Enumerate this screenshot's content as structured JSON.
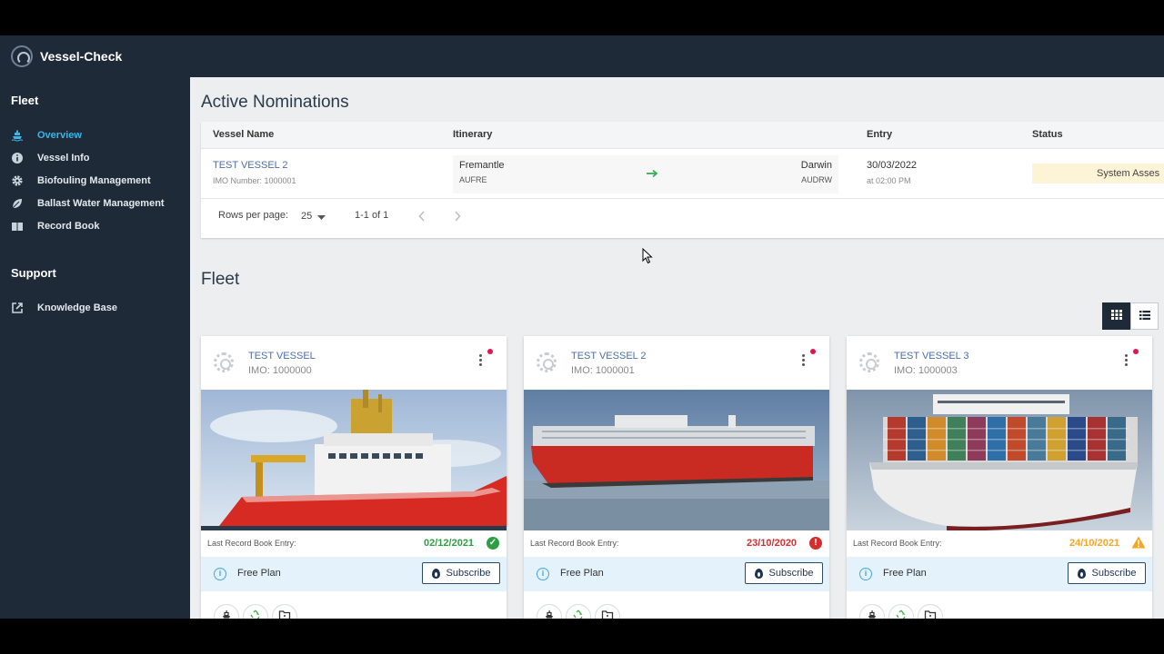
{
  "app": {
    "title": "Vessel-Check"
  },
  "sidebar": {
    "sections": [
      {
        "title": "Fleet",
        "items": [
          {
            "label": "Overview",
            "icon": "ship-icon",
            "active": true
          },
          {
            "label": "Vessel Info",
            "icon": "info-icon"
          },
          {
            "label": "Biofouling Management",
            "icon": "gear-icon"
          },
          {
            "label": "Ballast Water Management",
            "icon": "leaf-icon"
          },
          {
            "label": "Record Book",
            "icon": "book-icon"
          }
        ]
      },
      {
        "title": "Support",
        "items": [
          {
            "label": "Knowledge Base",
            "icon": "external-link-icon"
          }
        ]
      }
    ]
  },
  "nominations": {
    "title": "Active Nominations",
    "columns": [
      "Vessel Name",
      "Itinerary",
      "Entry",
      "Status"
    ],
    "rows": [
      {
        "vessel": "TEST VESSEL 2",
        "imo": "IMO Number: 1000001",
        "from_port": "Fremantle",
        "from_code": "AUFRE",
        "to_port": "Darwin",
        "to_code": "AUDRW",
        "entry_date": "30/03/2022",
        "entry_time": "at 02:00 PM",
        "status": "System Asses"
      }
    ],
    "pager": {
      "rows_label": "Rows per page:",
      "rows_value": "25",
      "range": "1-1 of 1"
    }
  },
  "fleet": {
    "title": "Fleet",
    "view_options": [
      "grid-view-icon",
      "list-view-icon"
    ],
    "cards": [
      {
        "name": "TEST VESSEL",
        "imo": "IMO: 1000000",
        "record_label": "Last Record Book Entry:",
        "record_date": "02/12/2021",
        "record_status": "ok",
        "status_color": "#2e9e44",
        "plan": "Free Plan",
        "subscribe": "Subscribe"
      },
      {
        "name": "TEST VESSEL 2",
        "imo": "IMO: 1000001",
        "record_label": "Last Record Book Entry:",
        "record_date": "23/10/2020",
        "record_status": "overdue",
        "status_color": "#d32f2f",
        "plan": "Free Plan",
        "subscribe": "Subscribe"
      },
      {
        "name": "TEST VESSEL 3",
        "imo": "IMO: 1000003",
        "record_label": "Last Record Book Entry:",
        "record_date": "24/10/2021",
        "record_status": "warning",
        "status_color": "#f5a623",
        "plan": "Free Plan",
        "subscribe": "Subscribe"
      }
    ]
  },
  "colors": {
    "sidebar_bg": "#1e2a38",
    "accent": "#3cb4e6",
    "link": "#4a6ea8"
  }
}
